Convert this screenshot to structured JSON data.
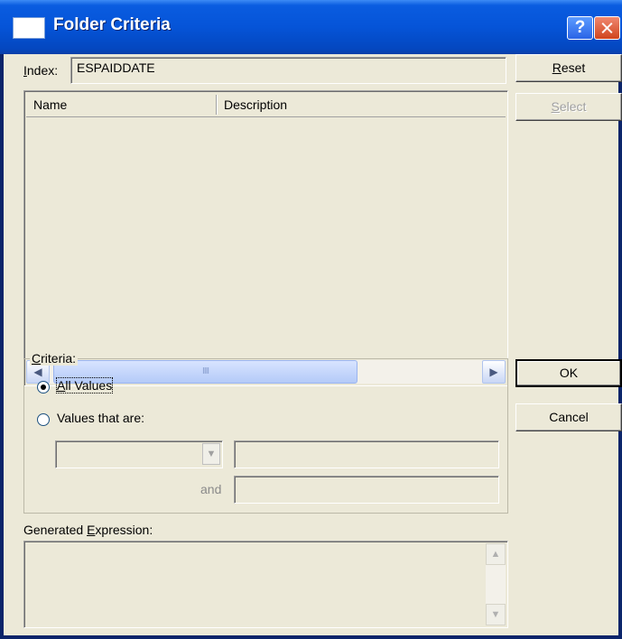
{
  "window": {
    "title": "Folder Criteria",
    "help_glyph": "?",
    "colors": {
      "titlebar": "#0554d8",
      "face": "#ece9d8",
      "close": "#d0441c"
    }
  },
  "index": {
    "label_hotkey": "I",
    "label_rest": "ndex:",
    "value": "ESPAIDDATE"
  },
  "buttons": {
    "reset_hotkey": "R",
    "reset_rest": "eset",
    "select_hotkey": "S",
    "select_rest": "elect",
    "ok": "OK",
    "cancel": "Cancel"
  },
  "list": {
    "columns": [
      "Name",
      "Description"
    ],
    "rows": [],
    "scroll_left_glyph": "◀",
    "scroll_right_glyph": "▶",
    "thumb_grip": "IIII"
  },
  "criteria": {
    "legend_hotkey": "C",
    "legend_rest": "riteria:",
    "option_all_hotkey": "A",
    "option_all_rest": "ll Values",
    "option_values": "Values that are:",
    "selected": "All Values",
    "and_label": "and",
    "operator_value": "",
    "value1": "",
    "value2": ""
  },
  "expression": {
    "label_prefix": "Generated ",
    "label_hotkey": "E",
    "label_rest": "xpression:",
    "value": ""
  },
  "icons": [
    "help-icon",
    "close-icon",
    "window-icon",
    "scroll-left-icon",
    "scroll-right-icon",
    "chevron-down-icon",
    "scroll-up-icon",
    "scroll-down-icon"
  ]
}
